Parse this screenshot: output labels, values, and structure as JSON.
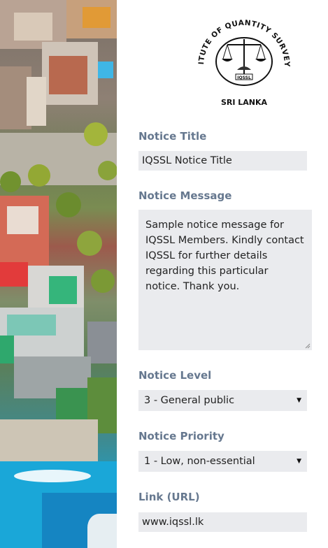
{
  "logo": {
    "arc_text": "INSTITUTE OF QUANTITY SURVEYORS",
    "bottom_text": "SRI LANKA",
    "badge_text": "IQSSL"
  },
  "form": {
    "title_label": "Notice Title",
    "title_value": "IQSSL Notice Title",
    "message_label": "Notice Message",
    "message_value": "Sample notice message for IQSSL Members. Kindly contact IQSSL for further details regarding this particular notice. Thank you.",
    "level_label": "Notice Level",
    "level_value": "3 - General public",
    "priority_label": "Notice Priority",
    "priority_value": "1 - Low, non-essential",
    "link_label": "Link (URL)",
    "link_value": "www.iqssl.lk"
  },
  "icons": {
    "dropdown": "▼"
  }
}
